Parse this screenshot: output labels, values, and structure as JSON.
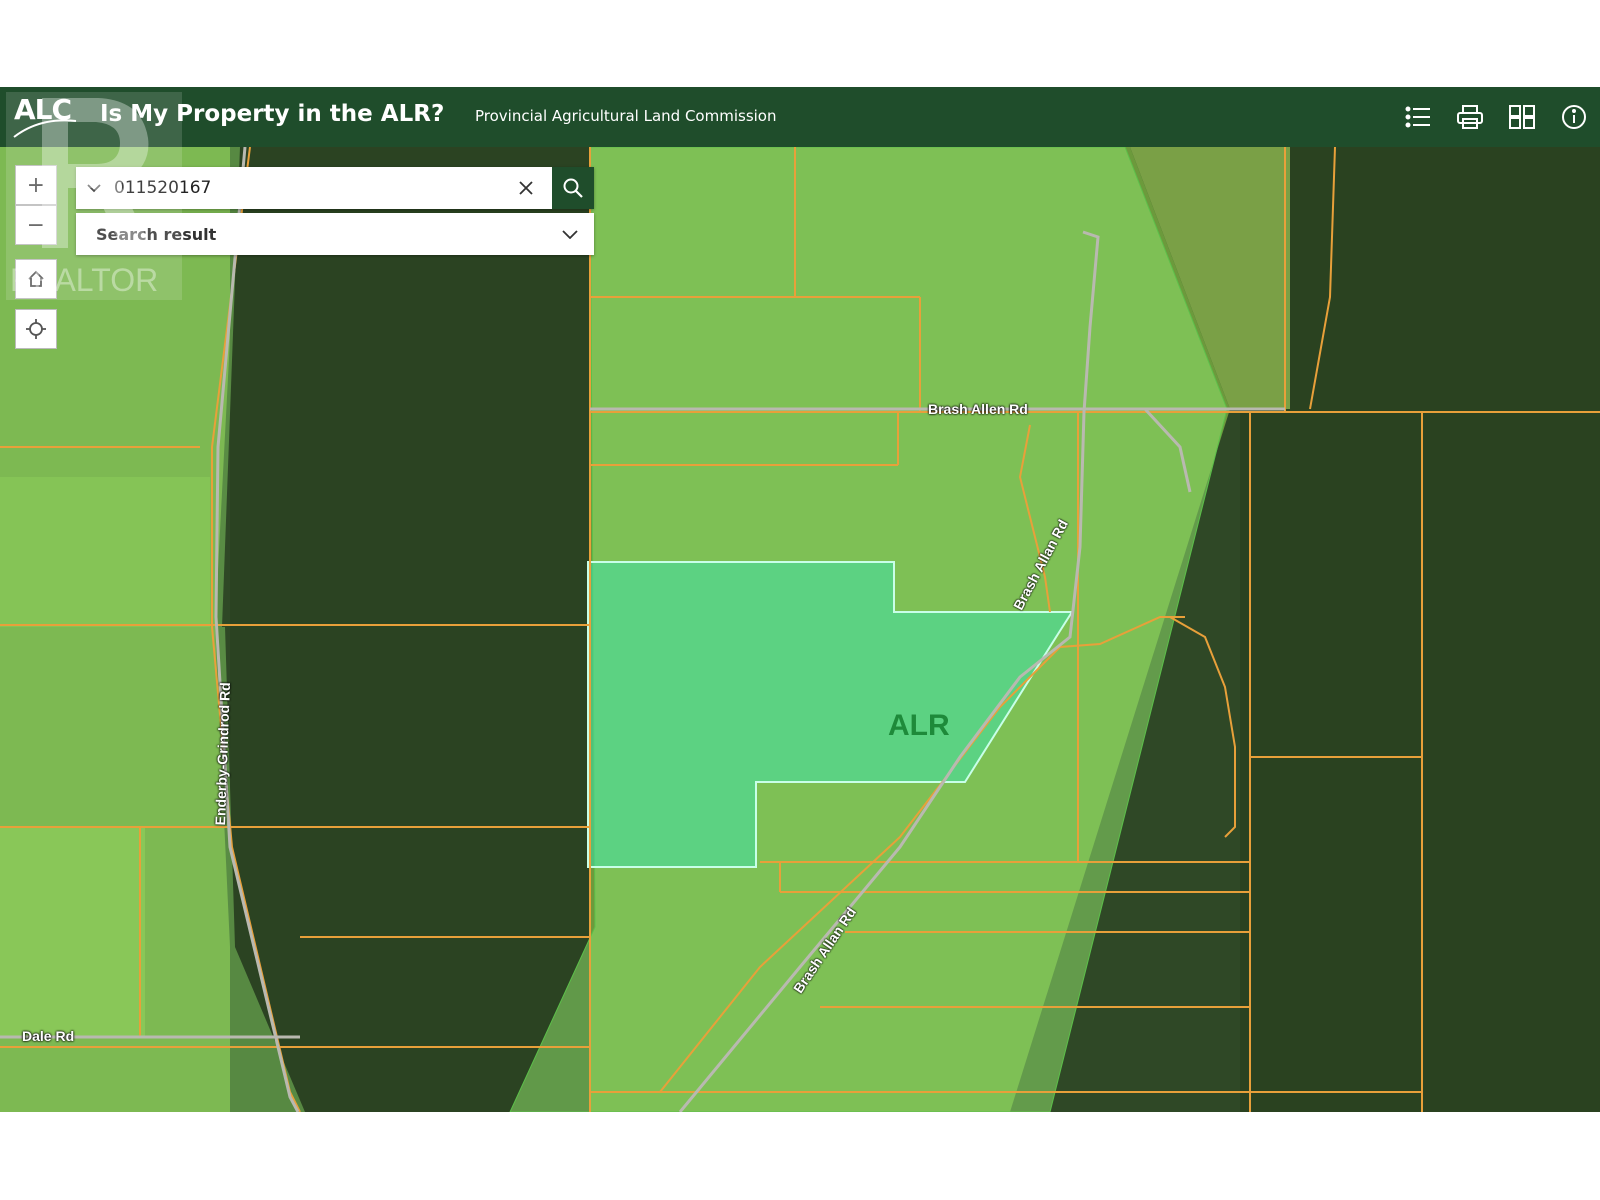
{
  "header": {
    "logo_text": "ALC",
    "title": "Is My Property in the ALR?",
    "subtitle": "Provincial Agricultural Land Commission",
    "tools": [
      {
        "icon": "list-icon"
      },
      {
        "icon": "print-icon"
      },
      {
        "icon": "grid-icon"
      },
      {
        "icon": "info-icon"
      }
    ]
  },
  "map_controls": {
    "zoom_in": "+",
    "zoom_out": "−"
  },
  "search": {
    "value": "011520167",
    "result_label": "Search result"
  },
  "map": {
    "zone_label": "ALR",
    "roads": {
      "brash_allen": "Brash Allen Rd",
      "brash_allan_north": "Brash Allan Rd",
      "brash_allan_south": "Brash Allan Rd",
      "enderby_grindrod": "Enderby-Grindrod Rd",
      "dale": "Dale Rd"
    },
    "colors": {
      "parcel_line": "#e8a03a",
      "alr_overlay": "#8ee06a",
      "selected_parcel": "#3fe0a8",
      "header": "#1f4d2b"
    }
  },
  "watermark": {
    "text": "REALTOR"
  }
}
